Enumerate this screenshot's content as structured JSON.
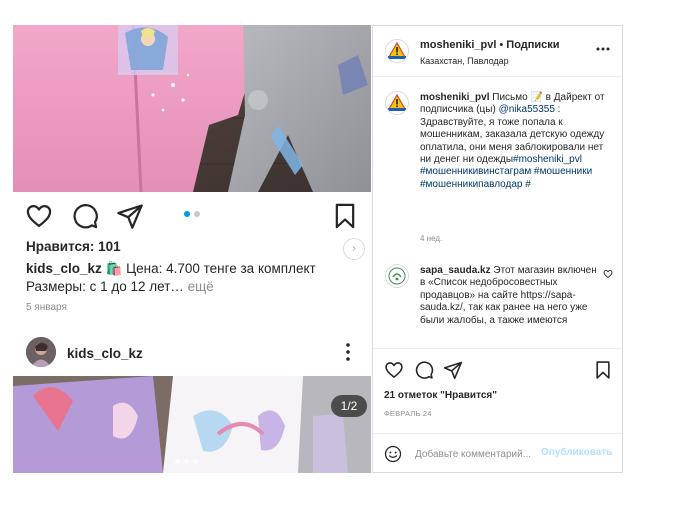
{
  "feed": {
    "post1": {
      "likes": "Нравится: 101",
      "caption_user": "kids_clo_kz",
      "caption_line1": "🛍️ Цена: 4.700 тенге за комплект",
      "caption_line2": "Размеры: с 1 до 12 лет…",
      "more": "ещё",
      "date": "5 января",
      "carousel_index": 0,
      "carousel_count": 2
    },
    "post2": {
      "username": "kids_clo_kz",
      "counter": "1/2",
      "carousel_index": 0,
      "carousel_count": 3
    }
  },
  "panel": {
    "header": {
      "username": "mosheniki_pvl",
      "separator": "•",
      "follow_label": "Подписки",
      "location": "Казахстан, Павлодар"
    },
    "caption": {
      "username": "mosheniki_pvl",
      "text": "Письмо 📝 в Дайрект от подписчика (цы) ",
      "mention": "@nika55355",
      "text2": " : Здравствуйте, я тоже попала к мошенникам, заказала детскую одежду оплатила, они меня заблокировали нет ни денег ни одежды",
      "hashtags": "#mosheniki_pvl #мошенникивинстаграм #мошенники #мошенникипавлодар #",
      "time": "4 нед."
    },
    "comment": {
      "username": "sapa_sauda.kz",
      "text": "Этот магазин включен в «Список недобросовестных продавцов» на сайте https://sapa-sauda.kz/, так как ранее на него уже были жалобы, а также имеются",
      "avatar_text": "SAPA SAUDA"
    },
    "likes": "21 отметок \"Нравится\"",
    "date": "ФЕВРАЛЬ 24",
    "comment_placeholder": "Добавьте комментарий...",
    "publish_label": "Опубликовать"
  },
  "colors": {
    "accent": "#0095f6",
    "link": "#00376b",
    "muted": "#8e8e8e",
    "border": "#dbdbdb",
    "publish_disabled": "#b2dffc"
  },
  "icons": [
    "heart-icon",
    "comment-icon",
    "share-icon",
    "bookmark-icon",
    "more-icon",
    "emoji-icon",
    "chevron-right-icon"
  ]
}
